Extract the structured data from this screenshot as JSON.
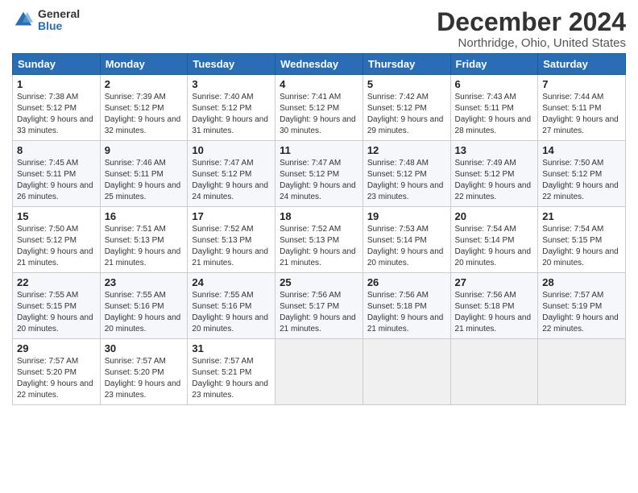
{
  "logo": {
    "general": "General",
    "blue": "Blue"
  },
  "title": "December 2024",
  "subtitle": "Northridge, Ohio, United States",
  "days_of_week": [
    "Sunday",
    "Monday",
    "Tuesday",
    "Wednesday",
    "Thursday",
    "Friday",
    "Saturday"
  ],
  "weeks": [
    [
      {
        "day": "1",
        "sunrise": "Sunrise: 7:38 AM",
        "sunset": "Sunset: 5:12 PM",
        "daylight": "Daylight: 9 hours and 33 minutes."
      },
      {
        "day": "2",
        "sunrise": "Sunrise: 7:39 AM",
        "sunset": "Sunset: 5:12 PM",
        "daylight": "Daylight: 9 hours and 32 minutes."
      },
      {
        "day": "3",
        "sunrise": "Sunrise: 7:40 AM",
        "sunset": "Sunset: 5:12 PM",
        "daylight": "Daylight: 9 hours and 31 minutes."
      },
      {
        "day": "4",
        "sunrise": "Sunrise: 7:41 AM",
        "sunset": "Sunset: 5:12 PM",
        "daylight": "Daylight: 9 hours and 30 minutes."
      },
      {
        "day": "5",
        "sunrise": "Sunrise: 7:42 AM",
        "sunset": "Sunset: 5:12 PM",
        "daylight": "Daylight: 9 hours and 29 minutes."
      },
      {
        "day": "6",
        "sunrise": "Sunrise: 7:43 AM",
        "sunset": "Sunset: 5:11 PM",
        "daylight": "Daylight: 9 hours and 28 minutes."
      },
      {
        "day": "7",
        "sunrise": "Sunrise: 7:44 AM",
        "sunset": "Sunset: 5:11 PM",
        "daylight": "Daylight: 9 hours and 27 minutes."
      }
    ],
    [
      {
        "day": "8",
        "sunrise": "Sunrise: 7:45 AM",
        "sunset": "Sunset: 5:11 PM",
        "daylight": "Daylight: 9 hours and 26 minutes."
      },
      {
        "day": "9",
        "sunrise": "Sunrise: 7:46 AM",
        "sunset": "Sunset: 5:11 PM",
        "daylight": "Daylight: 9 hours and 25 minutes."
      },
      {
        "day": "10",
        "sunrise": "Sunrise: 7:47 AM",
        "sunset": "Sunset: 5:12 PM",
        "daylight": "Daylight: 9 hours and 24 minutes."
      },
      {
        "day": "11",
        "sunrise": "Sunrise: 7:47 AM",
        "sunset": "Sunset: 5:12 PM",
        "daylight": "Daylight: 9 hours and 24 minutes."
      },
      {
        "day": "12",
        "sunrise": "Sunrise: 7:48 AM",
        "sunset": "Sunset: 5:12 PM",
        "daylight": "Daylight: 9 hours and 23 minutes."
      },
      {
        "day": "13",
        "sunrise": "Sunrise: 7:49 AM",
        "sunset": "Sunset: 5:12 PM",
        "daylight": "Daylight: 9 hours and 22 minutes."
      },
      {
        "day": "14",
        "sunrise": "Sunrise: 7:50 AM",
        "sunset": "Sunset: 5:12 PM",
        "daylight": "Daylight: 9 hours and 22 minutes."
      }
    ],
    [
      {
        "day": "15",
        "sunrise": "Sunrise: 7:50 AM",
        "sunset": "Sunset: 5:12 PM",
        "daylight": "Daylight: 9 hours and 21 minutes."
      },
      {
        "day": "16",
        "sunrise": "Sunrise: 7:51 AM",
        "sunset": "Sunset: 5:13 PM",
        "daylight": "Daylight: 9 hours and 21 minutes."
      },
      {
        "day": "17",
        "sunrise": "Sunrise: 7:52 AM",
        "sunset": "Sunset: 5:13 PM",
        "daylight": "Daylight: 9 hours and 21 minutes."
      },
      {
        "day": "18",
        "sunrise": "Sunrise: 7:52 AM",
        "sunset": "Sunset: 5:13 PM",
        "daylight": "Daylight: 9 hours and 21 minutes."
      },
      {
        "day": "19",
        "sunrise": "Sunrise: 7:53 AM",
        "sunset": "Sunset: 5:14 PM",
        "daylight": "Daylight: 9 hours and 20 minutes."
      },
      {
        "day": "20",
        "sunrise": "Sunrise: 7:54 AM",
        "sunset": "Sunset: 5:14 PM",
        "daylight": "Daylight: 9 hours and 20 minutes."
      },
      {
        "day": "21",
        "sunrise": "Sunrise: 7:54 AM",
        "sunset": "Sunset: 5:15 PM",
        "daylight": "Daylight: 9 hours and 20 minutes."
      }
    ],
    [
      {
        "day": "22",
        "sunrise": "Sunrise: 7:55 AM",
        "sunset": "Sunset: 5:15 PM",
        "daylight": "Daylight: 9 hours and 20 minutes."
      },
      {
        "day": "23",
        "sunrise": "Sunrise: 7:55 AM",
        "sunset": "Sunset: 5:16 PM",
        "daylight": "Daylight: 9 hours and 20 minutes."
      },
      {
        "day": "24",
        "sunrise": "Sunrise: 7:55 AM",
        "sunset": "Sunset: 5:16 PM",
        "daylight": "Daylight: 9 hours and 20 minutes."
      },
      {
        "day": "25",
        "sunrise": "Sunrise: 7:56 AM",
        "sunset": "Sunset: 5:17 PM",
        "daylight": "Daylight: 9 hours and 21 minutes."
      },
      {
        "day": "26",
        "sunrise": "Sunrise: 7:56 AM",
        "sunset": "Sunset: 5:18 PM",
        "daylight": "Daylight: 9 hours and 21 minutes."
      },
      {
        "day": "27",
        "sunrise": "Sunrise: 7:56 AM",
        "sunset": "Sunset: 5:18 PM",
        "daylight": "Daylight: 9 hours and 21 minutes."
      },
      {
        "day": "28",
        "sunrise": "Sunrise: 7:57 AM",
        "sunset": "Sunset: 5:19 PM",
        "daylight": "Daylight: 9 hours and 22 minutes."
      }
    ],
    [
      {
        "day": "29",
        "sunrise": "Sunrise: 7:57 AM",
        "sunset": "Sunset: 5:20 PM",
        "daylight": "Daylight: 9 hours and 22 minutes."
      },
      {
        "day": "30",
        "sunrise": "Sunrise: 7:57 AM",
        "sunset": "Sunset: 5:20 PM",
        "daylight": "Daylight: 9 hours and 23 minutes."
      },
      {
        "day": "31",
        "sunrise": "Sunrise: 7:57 AM",
        "sunset": "Sunset: 5:21 PM",
        "daylight": "Daylight: 9 hours and 23 minutes."
      },
      null,
      null,
      null,
      null
    ]
  ]
}
